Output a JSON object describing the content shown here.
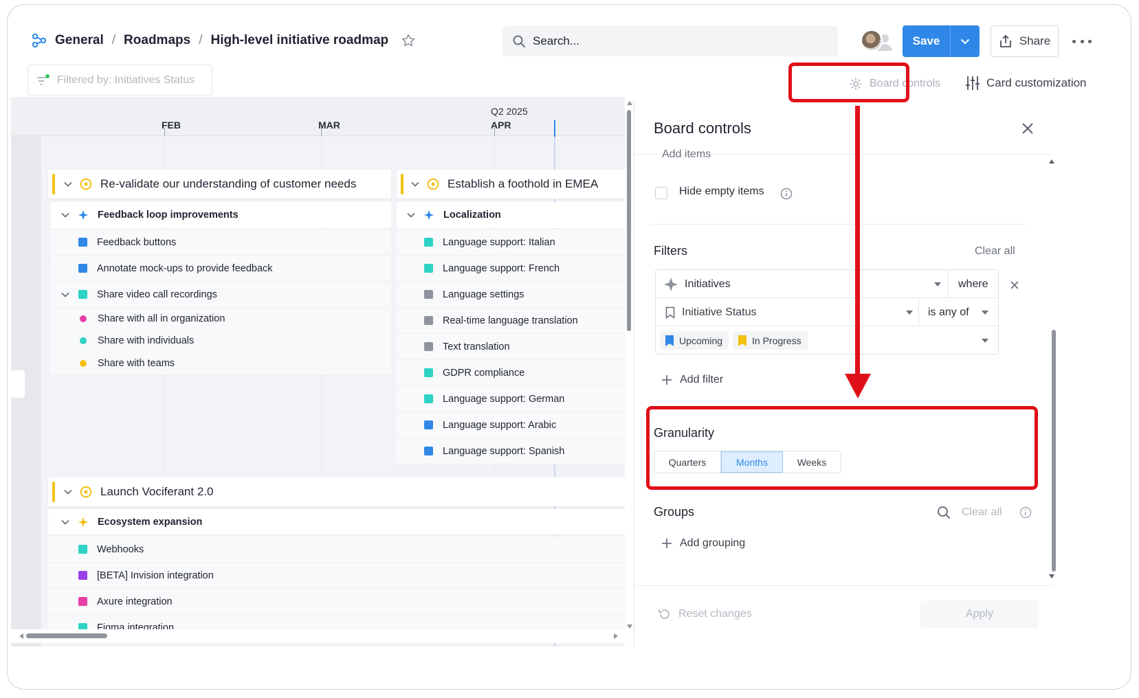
{
  "breadcrumb": {
    "items": [
      "General",
      "Roadmaps",
      "High-level initiative roadmap"
    ],
    "separator": "/"
  },
  "search": {
    "placeholder": "Search..."
  },
  "toolbar": {
    "save_label": "Save",
    "share_label": "Share"
  },
  "filter_chip": {
    "label": "Filtered by: Initiatives Status"
  },
  "board_controls_label": "Board controls",
  "card_customization_label": "Card customization",
  "timeline": {
    "quarter": "Q2 2025",
    "months": [
      "FEB",
      "MAR",
      "APR"
    ],
    "groups": [
      {
        "title": "Re-validate our understanding of customer needs",
        "feature": "Feedback loop improvements",
        "items": [
          {
            "label": "Feedback buttons",
            "color": "#2f88e8"
          },
          {
            "label": "Annotate mock-ups to provide feedback",
            "color": "#2f88e8"
          },
          {
            "label": "Share video call recordings",
            "color": "#2ed3c5"
          },
          {
            "label": "Share with all in organization",
            "color": "#e83fa6"
          },
          {
            "label": "Share with individuals",
            "color": "#2ed3c5"
          },
          {
            "label": "Share with teams",
            "color": "#f4c010"
          }
        ]
      },
      {
        "title": "Establish a foothold in EMEA",
        "feature": "Localization",
        "items": [
          {
            "label": "Language support: Italian",
            "color": "#2ed3c5"
          },
          {
            "label": "Language support: French",
            "color": "#2ed3c5"
          },
          {
            "label": "Language settings",
            "color": "#8f949c"
          },
          {
            "label": "Real-time language translation",
            "color": "#8f949c"
          },
          {
            "label": "Text translation",
            "color": "#8f949c"
          },
          {
            "label": "GDPR compliance",
            "color": "#2ed3c5"
          },
          {
            "label": "Language support: German",
            "color": "#2ed3c5"
          },
          {
            "label": "Language support: Arabic",
            "color": "#2f88e8"
          },
          {
            "label": "Language support: Spanish",
            "color": "#2f88e8"
          }
        ]
      },
      {
        "title": "Launch Vociferant 2.0",
        "feature": "Ecosystem expansion",
        "items": [
          {
            "label": "Webhooks",
            "color": "#2ed3c5"
          },
          {
            "label": "[BETA] Invision integration",
            "color": "#9b3fe8"
          },
          {
            "label": "Axure integration",
            "color": "#e83fa6"
          },
          {
            "label": "Figma integration",
            "color": "#2ed3c5"
          }
        ]
      }
    ]
  },
  "panel": {
    "title": "Board controls",
    "cut_label": "Add items",
    "hide_empty_label": "Hide empty items",
    "filters": {
      "title": "Filters",
      "clear_label": "Clear all",
      "entity": "Initiatives",
      "where": "where",
      "field": "Initiative Status",
      "operator": "is any of",
      "values": [
        "Upcoming",
        "In Progress"
      ],
      "add_label": "Add filter"
    },
    "granularity": {
      "title": "Granularity",
      "options": [
        "Quarters",
        "Months",
        "Weeks"
      ],
      "selected": "Months"
    },
    "groups": {
      "title": "Groups",
      "clear_label": "Clear all",
      "add_label": "Add grouping"
    },
    "reset_label": "Reset changes",
    "apply_label": "Apply"
  },
  "colors": {
    "accent": "#2f88e8",
    "annotation": "#e0101a",
    "initiative_bar": "#f4c010"
  }
}
